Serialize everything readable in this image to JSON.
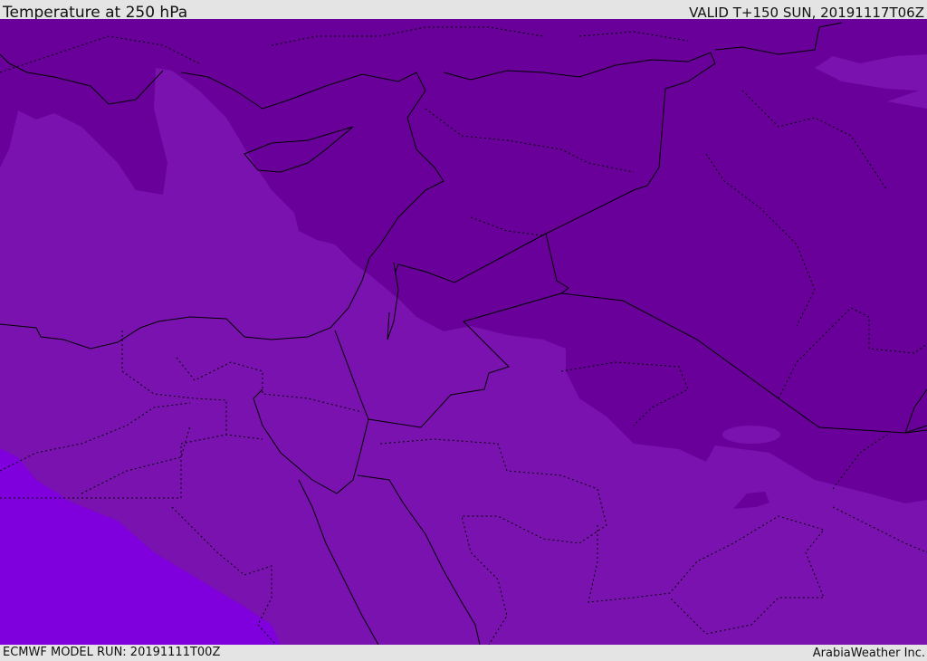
{
  "header": {
    "title": "Temperature at 250 hPa",
    "valid_time": "VALID T+150 SUN, 20191117T06Z"
  },
  "footer": {
    "model_run": "ECMWF MODEL RUN: 20191111T00Z",
    "credit": "ArabiaWeather Inc."
  },
  "colors": {
    "cold_band": "#680099",
    "mid_band": "#7a12b0",
    "warm_band": "#7f00dc",
    "coastline": "#000000"
  }
}
